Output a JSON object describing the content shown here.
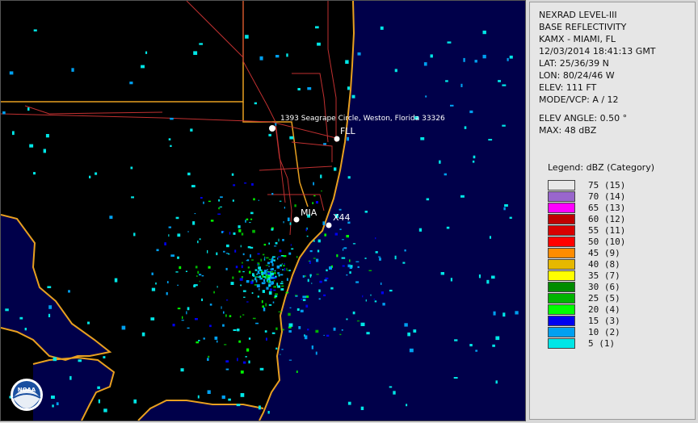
{
  "header": {
    "product": "NEXRAD LEVEL-III",
    "type": "BASE REFLECTIVITY",
    "station": "KAMX - MIAMI, FL",
    "datetime": "12/03/2014 18:41:13 GMT",
    "lat": "LAT: 25/36/39 N",
    "lon": "LON: 80/24/46 W",
    "elev": "ELEV: 111 FT",
    "mode": "MODE/VCP: A / 12",
    "elev_angle": "ELEV ANGLE: 0.50 °",
    "max": "MAX: 48 dBZ"
  },
  "legend": {
    "title": "Legend: dBZ (Category)",
    "items": [
      {
        "value": "75",
        "category": "(15)",
        "color": "#e8e8e8"
      },
      {
        "value": "70",
        "category": "(14)",
        "color": "#9966cc"
      },
      {
        "value": "65",
        "category": "(13)",
        "color": "#ff00ff"
      },
      {
        "value": "60",
        "category": "(12)",
        "color": "#c00000"
      },
      {
        "value": "55",
        "category": "(11)",
        "color": "#d80000"
      },
      {
        "value": "50",
        "category": "(10)",
        "color": "#ff0000"
      },
      {
        "value": "45",
        "category": "(9)",
        "color": "#ff8c00"
      },
      {
        "value": "40",
        "category": "(8)",
        "color": "#e6b800"
      },
      {
        "value": "35",
        "category": "(7)",
        "color": "#ffff00"
      },
      {
        "value": "30",
        "category": "(6)",
        "color": "#008c00"
      },
      {
        "value": "25",
        "category": "(5)",
        "color": "#00b400"
      },
      {
        "value": "20",
        "category": "(4)",
        "color": "#00ff00"
      },
      {
        "value": "15",
        "category": "(3)",
        "color": "#0000f0"
      },
      {
        "value": "10",
        "category": "(2)",
        "color": "#00a0f0"
      },
      {
        "value": "5",
        "category": "(1)",
        "color": "#00e6e6"
      }
    ]
  },
  "map": {
    "markers": {
      "address": "1393 Seagrape Circle, Weston, Florida 33326",
      "fll": "FLL",
      "mia": "MIA",
      "x44": "X44"
    },
    "logo": "NOAA"
  }
}
